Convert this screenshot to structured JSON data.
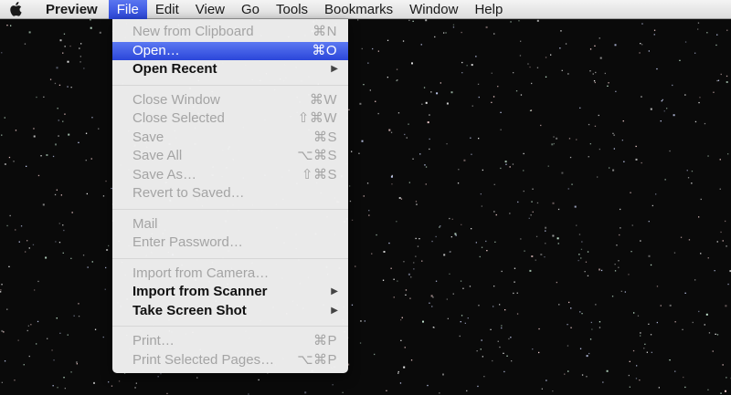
{
  "menubar": {
    "apple_icon": "apple-logo-icon",
    "menus": [
      {
        "label": "Preview",
        "active": false
      },
      {
        "label": "File",
        "active": true
      },
      {
        "label": "Edit",
        "active": false
      },
      {
        "label": "View",
        "active": false
      },
      {
        "label": "Go",
        "active": false
      },
      {
        "label": "Tools",
        "active": false
      },
      {
        "label": "Bookmarks",
        "active": false
      },
      {
        "label": "Window",
        "active": false
      },
      {
        "label": "Help",
        "active": false
      }
    ]
  },
  "file_menu": {
    "groups": [
      [
        {
          "label": "New from Clipboard",
          "shortcut": "⌘N",
          "enabled": false
        },
        {
          "label": "Open…",
          "shortcut": "⌘O",
          "enabled": true,
          "highlighted": true
        },
        {
          "label": "Open Recent",
          "submenu": true,
          "enabled": true
        }
      ],
      [
        {
          "label": "Close Window",
          "shortcut": "⌘W",
          "enabled": false
        },
        {
          "label": "Close Selected",
          "shortcut": "⇧⌘W",
          "enabled": false
        },
        {
          "label": "Save",
          "shortcut": "⌘S",
          "enabled": false
        },
        {
          "label": "Save All",
          "shortcut": "⌥⌘S",
          "enabled": false
        },
        {
          "label": "Save As…",
          "shortcut": "⇧⌘S",
          "enabled": false
        },
        {
          "label": "Revert to Saved…",
          "enabled": false
        }
      ],
      [
        {
          "label": "Mail",
          "enabled": false
        },
        {
          "label": "Enter Password…",
          "enabled": false
        }
      ],
      [
        {
          "label": "Import from Camera…",
          "enabled": false
        },
        {
          "label": "Import from Scanner",
          "submenu": true,
          "enabled": true
        },
        {
          "label": "Take Screen Shot",
          "submenu": true,
          "enabled": true
        }
      ],
      [
        {
          "label": "Print…",
          "shortcut": "⌘P",
          "enabled": false
        },
        {
          "label": "Print Selected Pages…",
          "shortcut": "⌥⌘P",
          "enabled": false
        }
      ]
    ],
    "submenu_glyph": "▶"
  },
  "colors": {
    "highlight": "#3a57e6",
    "desktop": "#0a0a0a"
  }
}
